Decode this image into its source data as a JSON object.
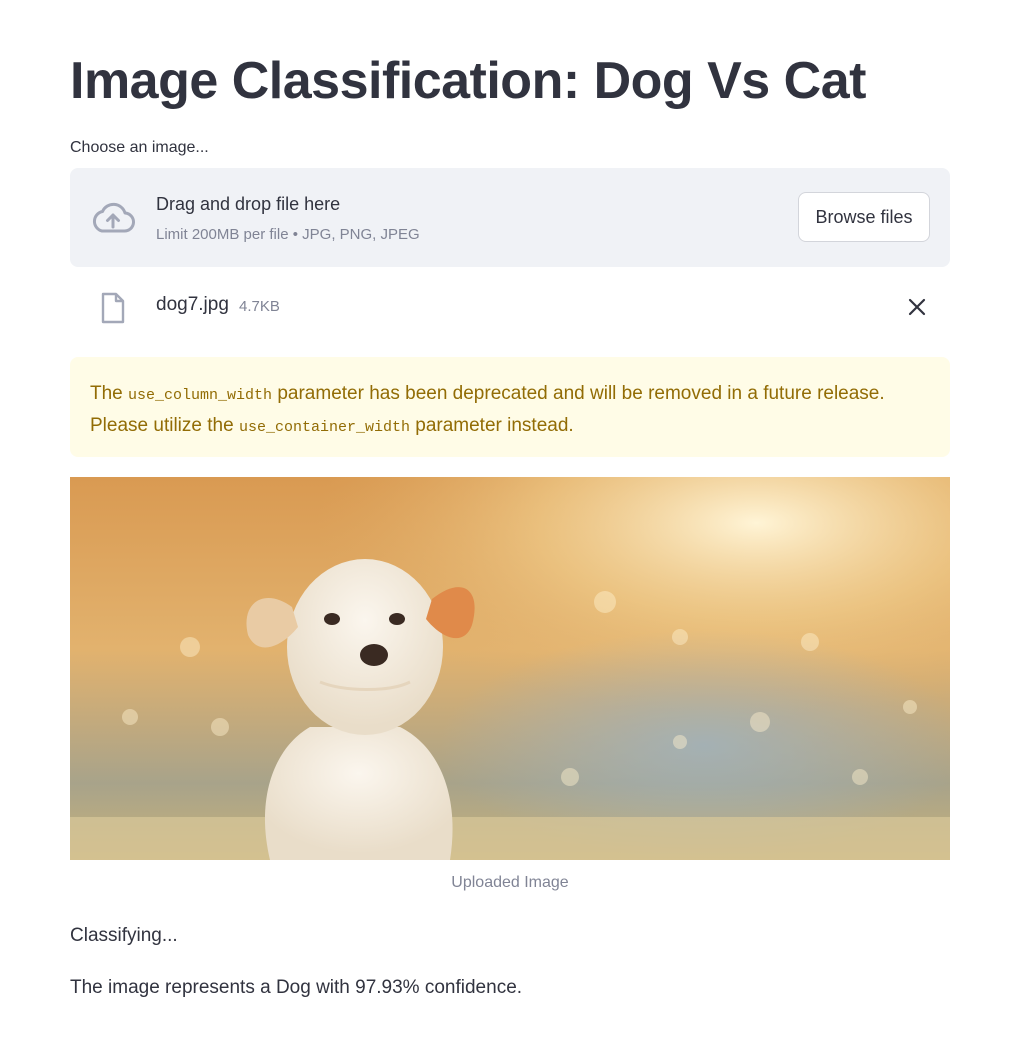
{
  "page": {
    "title": "Image Classification: Dog Vs Cat"
  },
  "uploader": {
    "label": "Choose an image...",
    "dropzone_title": "Drag and drop file here",
    "dropzone_subtitle": "Limit 200MB per file • JPG, PNG, JPEG",
    "browse_label": "Browse files",
    "icon": "cloud-upload-icon"
  },
  "uploaded_file": {
    "name": "dog7.jpg",
    "size": "4.7KB",
    "icon": "file-icon",
    "remove_icon": "close-icon"
  },
  "warning": {
    "prefix": "The",
    "param_old": "use_column_width",
    "middle": "parameter has been deprecated and will be removed in a future release. Please utilize the",
    "param_new": "use_container_width",
    "suffix": "parameter instead."
  },
  "image": {
    "caption": "Uploaded Image"
  },
  "result": {
    "status": "Classifying...",
    "message": "The image represents a Dog with 97.93% confidence."
  },
  "colors": {
    "text": "#31333f",
    "muted": "#808495",
    "dropzone_bg": "#f0f2f6",
    "warning_bg": "#fffce7",
    "warning_text": "#926c05",
    "icon": "#a3a8b8"
  }
}
